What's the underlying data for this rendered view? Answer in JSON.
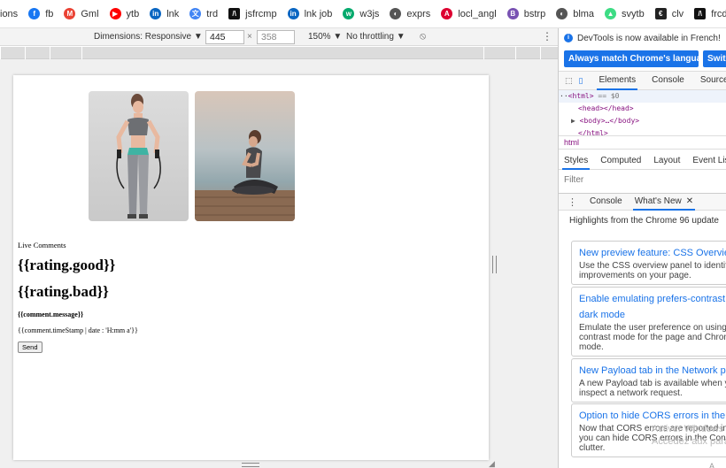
{
  "bookmarks": [
    {
      "label": "ions",
      "icon": "none",
      "color": ""
    },
    {
      "label": "fb",
      "icon": "facebook-icon",
      "color": "#1877f2"
    },
    {
      "label": "Gml",
      "icon": "gmail-icon",
      "color": "#ea4335"
    },
    {
      "label": "ytb",
      "icon": "youtube-icon",
      "color": "#ff0000"
    },
    {
      "label": "lnk",
      "icon": "linkedin-icon",
      "color": "#0a66c2"
    },
    {
      "label": "trd",
      "icon": "translate-icon",
      "color": "#4285f4"
    },
    {
      "label": "jsfrcmp",
      "icon": "jsframework-icon",
      "color": "#111111"
    },
    {
      "label": "lnk job",
      "icon": "linkedin-icon",
      "color": "#0a66c2"
    },
    {
      "label": "w3js",
      "icon": "w3schools-icon",
      "color": "#04aa6d"
    },
    {
      "label": "exprs",
      "icon": "globe-icon",
      "color": "#555555"
    },
    {
      "label": "locl_angl",
      "icon": "angular-icon",
      "color": "#dd0031"
    },
    {
      "label": "bstrp",
      "icon": "bootstrap-icon",
      "color": "#7952b3"
    },
    {
      "label": "blma",
      "icon": "globe-icon",
      "color": "#555555"
    },
    {
      "label": "svytb",
      "icon": "android-icon",
      "color": "#3ddc84"
    },
    {
      "label": "clv",
      "icon": "clv-icon",
      "color": "#222222"
    },
    {
      "label": "frcdcmp",
      "icon": "jsframework-icon",
      "color": "#111111"
    }
  ],
  "device_toolbar": {
    "dimensions": "Dimensions: Responsive ▼",
    "width": "445",
    "times": "×",
    "height": "358",
    "zoom": "150% ▼",
    "throttle": "No throttling ▼",
    "rotate_icon": "rotate-icon",
    "more_icon": "more-icon"
  },
  "page": {
    "image_1_icon": "fitness-woman-jumprope-photo",
    "image_2_icon": "yoga-woman-beach-photo",
    "live_comments": "Live Comments",
    "rating_good": "{{rating.good}}",
    "rating_bad": "{{rating.bad}}",
    "comment_message": "{{comment.message}}",
    "comment_timestamp": "{{comment.timeStamp | date : 'H:mm a'}}",
    "send": "Send"
  },
  "devtools": {
    "notice": "DevTools is now available in French!",
    "match_button": "Always match Chrome's language",
    "switch_button": "Switch",
    "tabs": [
      "Elements",
      "Console",
      "Sources"
    ],
    "dom_line1_tag": "<html>",
    "dom_line1_eq": "== $0",
    "dom_line2": "<head></head>",
    "dom_line3": "<body>…</body>",
    "dom_line4": "</html>",
    "breadcrumb": "html",
    "style_tabs": [
      "Styles",
      "Computed",
      "Layout",
      "Event Listeners"
    ],
    "filter": "Filter",
    "drawer_tabs": [
      "Console",
      "What's New"
    ],
    "highlights": "Highlights from the Chrome 96 update",
    "cards": [
      {
        "title": "New preview feature: CSS Overview",
        "lines": [
          "Use the CSS overview panel to identify",
          "improvements on your page."
        ]
      },
      {
        "title": "Enable emulating prefers-contrast",
        "title2": "dark mode",
        "lines": [
          "Emulate the user preference on using",
          "contrast mode for the page and Chrome",
          "mode."
        ]
      },
      {
        "title": "New Payload tab in the Network panel",
        "lines": [
          "A new Payload tab is available when you",
          "inspect a network request."
        ]
      },
      {
        "title": "Option to hide CORS errors in the Console",
        "lines": [
          "Now that CORS errors are reported in the",
          "you can hide CORS errors in the Console",
          "clutter."
        ]
      }
    ],
    "watermark_line1": "Activer Windows",
    "watermark_line2": "Accédez aux paramètres",
    "watermark_line3": "A"
  }
}
